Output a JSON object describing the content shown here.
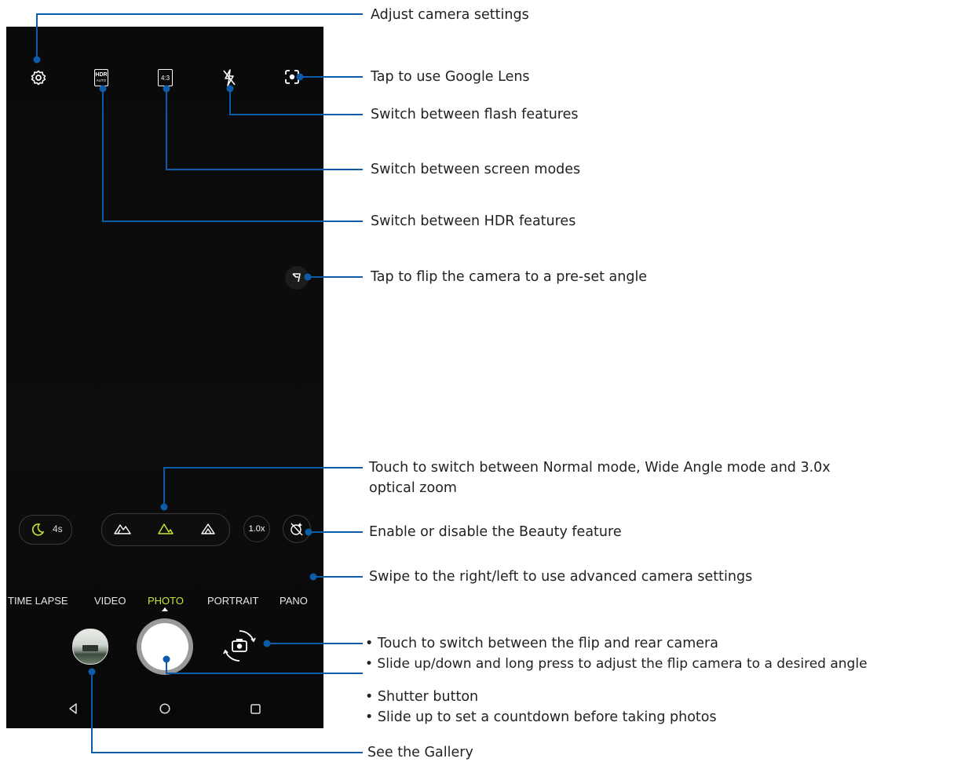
{
  "camera": {
    "top_icons": [
      "gear-icon",
      "hdr-auto-icon",
      "aspect-4-3-icon",
      "flash-off-icon",
      "google-lens-icon"
    ],
    "hdr_badge": {
      "top": "HDR",
      "bottom": "AUTO"
    },
    "aspect_badge": "4:3",
    "night": {
      "label": "4s"
    },
    "zoom": {
      "label": "1.0x"
    },
    "lenses": [
      "wide-angle-icon",
      "normal-lens-icon",
      "zoom-lens-icon"
    ],
    "modes": [
      {
        "label": "TIME LAPSE",
        "active": false
      },
      {
        "label": "VIDEO",
        "active": false
      },
      {
        "label": "PHOTO",
        "active": true
      },
      {
        "label": "PORTRAIT",
        "active": false
      },
      {
        "label": "PANO",
        "active": false
      }
    ],
    "active_color": "#c8e632",
    "nav": [
      "back-icon",
      "home-icon",
      "recents-icon"
    ]
  },
  "callouts": {
    "settings": "Adjust camera settings",
    "lens": "Tap to use Google Lens",
    "flash": "Switch between flash features",
    "screen": "Switch between screen modes",
    "hdr": "Switch between HDR features",
    "flip_angle": "Tap to flip the camera to a pre-set angle",
    "lens_switch_1": "Touch to switch between Normal mode, Wide Angle mode and 3.0x",
    "lens_switch_2": "optical zoom",
    "beauty": "Enable or disable the Beauty feature",
    "swipe": "Swipe to the right/left to use advanced camera settings",
    "flip_1": "• Touch to switch between the flip and rear camera",
    "flip_2": "• Slide up/down and long press to adjust the flip camera to a desired angle",
    "shutter_1": "• Shutter button",
    "shutter_2": "• Slide up to set a countdown before taking photos",
    "gallery": "See the Gallery"
  },
  "line_color": "#0c5ca8"
}
